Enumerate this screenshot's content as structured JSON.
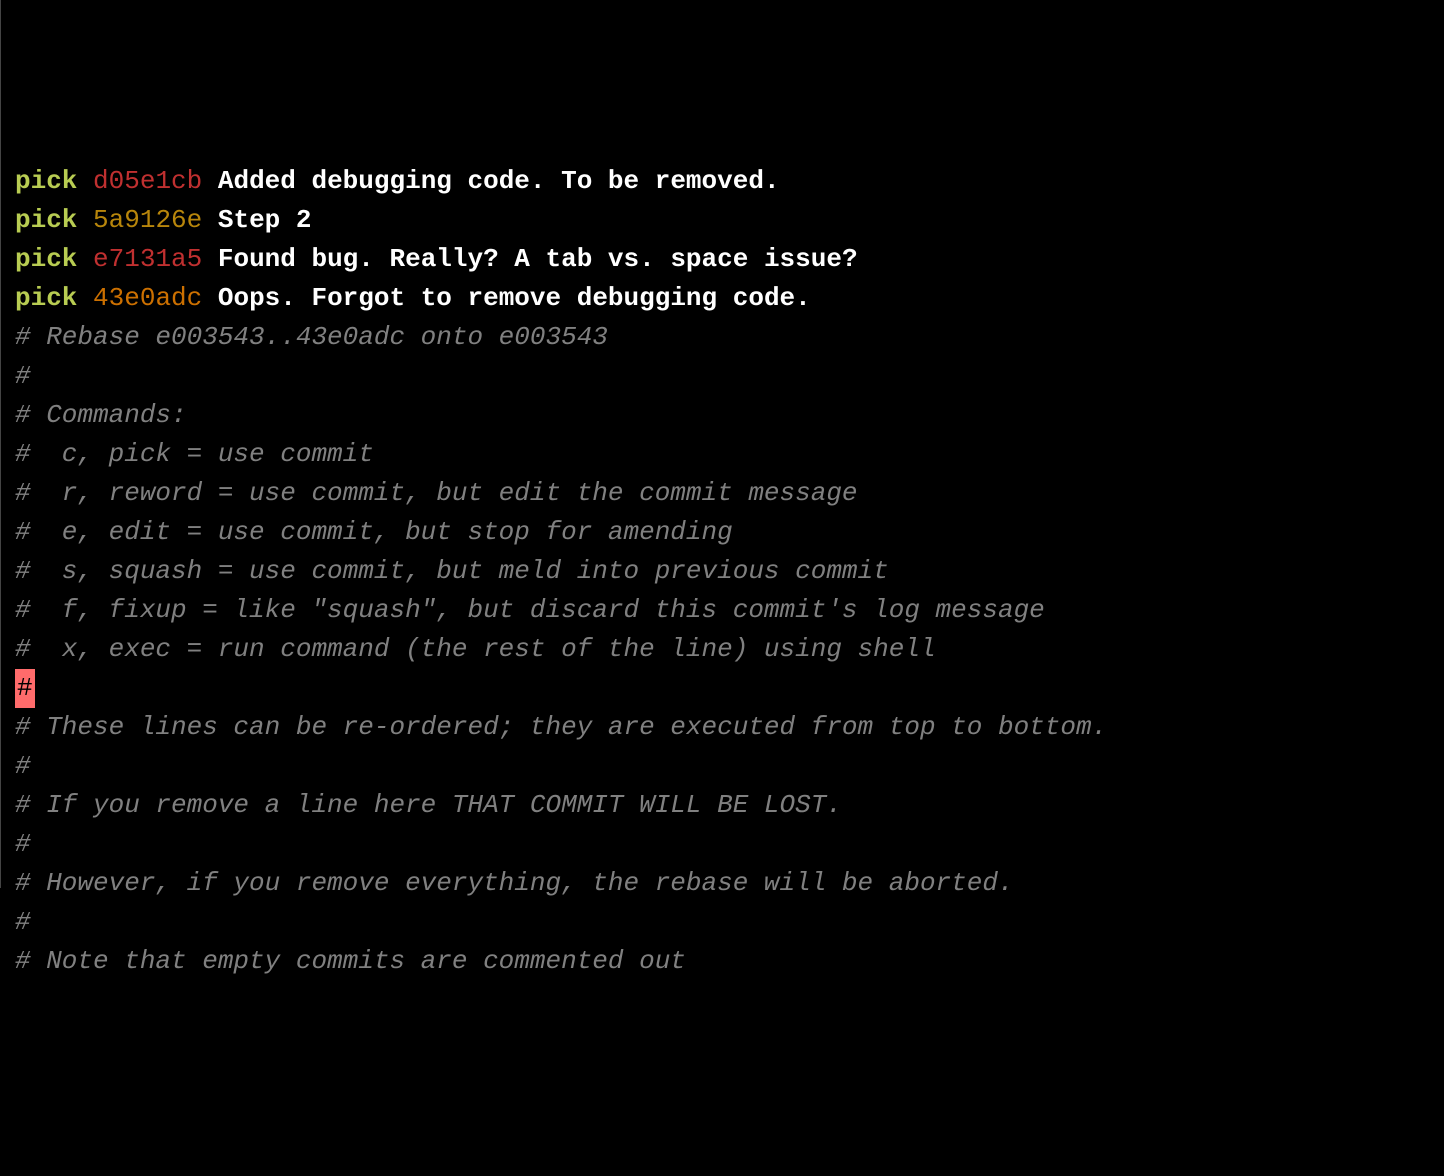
{
  "commits": [
    {
      "action": "pick",
      "hash": "d05e1cb",
      "hashClass": "h-d",
      "message": "Added debugging code. To be removed."
    },
    {
      "action": "pick",
      "hash": "5a9126e",
      "hashClass": "h-5",
      "message": "Step 2"
    },
    {
      "action": "pick",
      "hash": "e7131a5",
      "hashClass": "h-e",
      "message": "Found bug. Really? A tab vs. space issue?"
    },
    {
      "action": "pick",
      "hash": "43e0adc",
      "hashClass": "h-4",
      "message": "Oops. Forgot to remove debugging code."
    }
  ],
  "blank": "",
  "rebase_header": "# Rebase e003543..43e0adc onto e003543",
  "hash_only": "#",
  "commands_header": "# Commands:",
  "cmd_pick": "#  c, pick = use commit",
  "cmd_reword": "#  r, reword = use commit, but edit the commit message",
  "cmd_edit": "#  e, edit = use commit, but stop for amending",
  "cmd_squash": "#  s, squash = use commit, but meld into previous commit",
  "cmd_fixup": "#  f, fixup = like \"squash\", but discard this commit's log message",
  "cmd_exec": "#  x, exec = run command (the rest of the line) using shell",
  "cursor_hash": "#",
  "note_reorder": "# These lines can be re-ordered; they are executed from top to bottom.",
  "note_remove": "# If you remove a line here THAT COMMIT WILL BE LOST.",
  "note_abort": "# However, if you remove everything, the rebase will be aborted.",
  "note_empty": "# Note that empty commits are commented out"
}
